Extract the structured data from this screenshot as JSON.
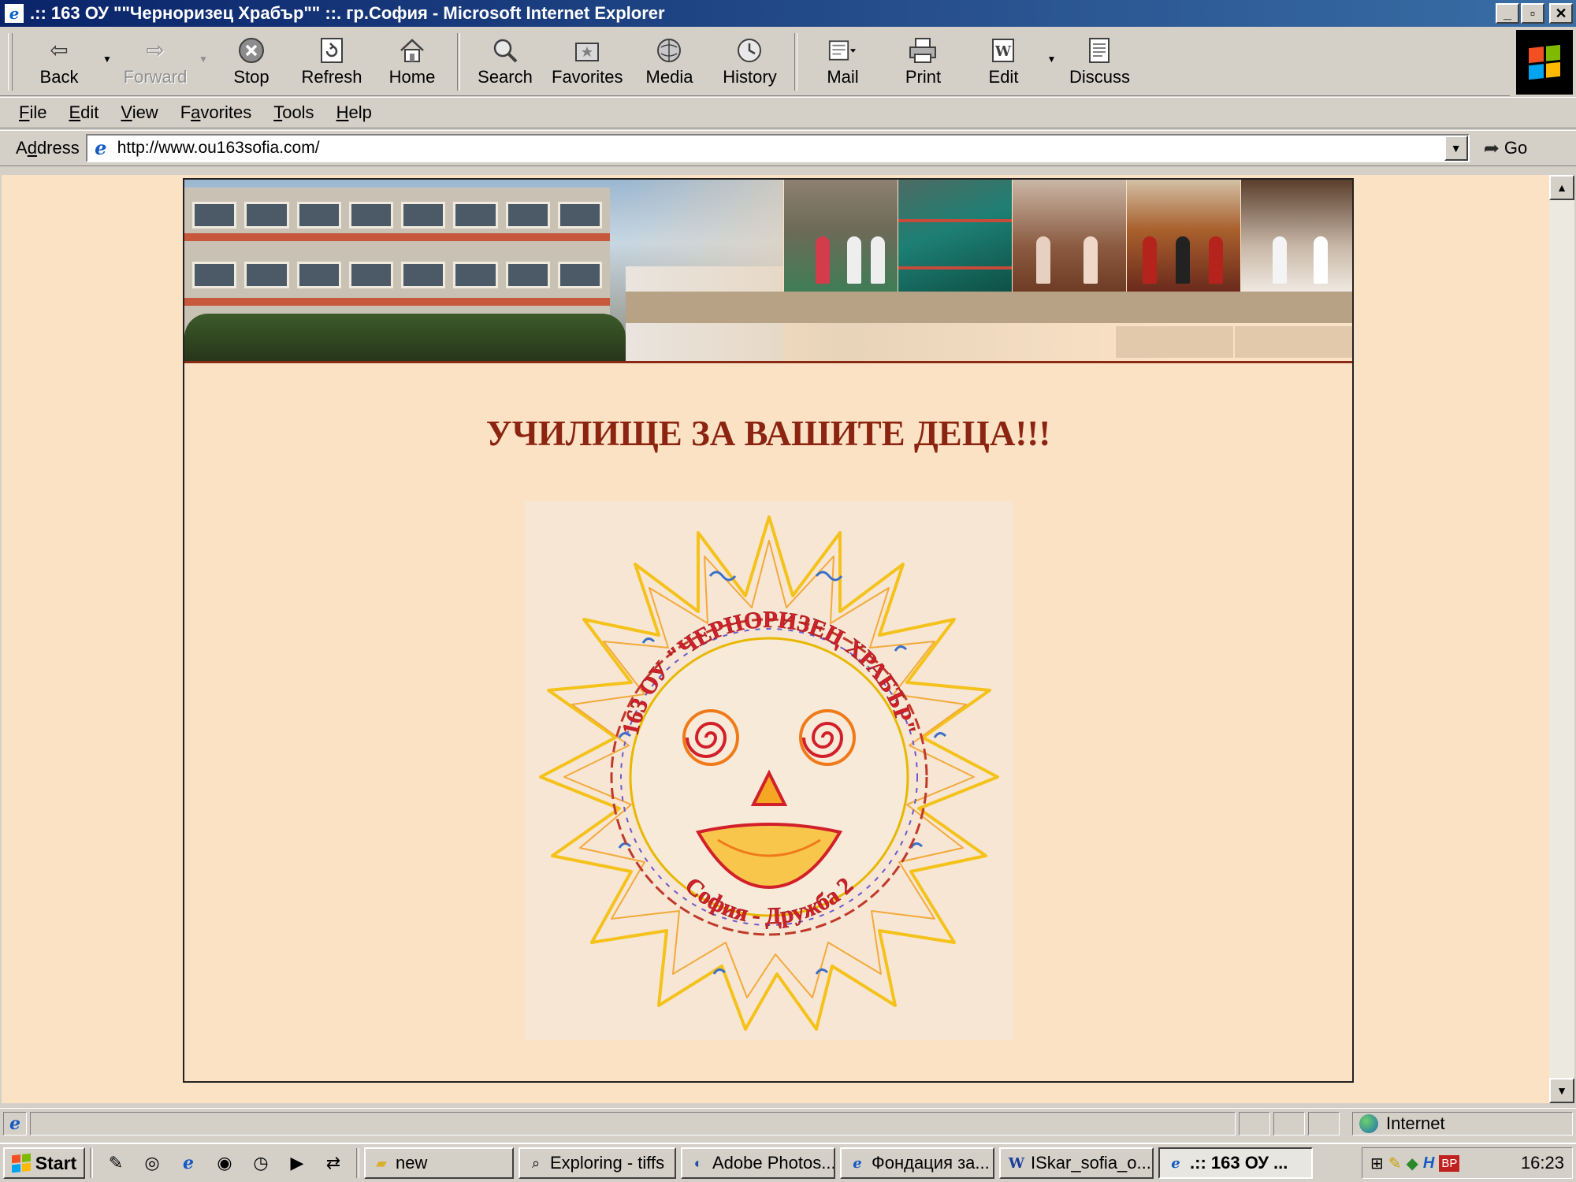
{
  "window": {
    "title": ".:: 163 ОУ \"\"Черноризец Храбър\"\" ::. гр.София - Microsoft Internet Explorer",
    "controls": {
      "minimize": "_",
      "maximize": "▫",
      "close": "✕"
    }
  },
  "toolbar": {
    "buttons": [
      {
        "label": "Back",
        "icon": "back-arrow-icon",
        "enabled": true
      },
      {
        "label": "Forward",
        "icon": "forward-arrow-icon",
        "enabled": false
      },
      {
        "label": "Stop",
        "icon": "stop-icon",
        "enabled": true
      },
      {
        "label": "Refresh",
        "icon": "refresh-icon",
        "enabled": true
      },
      {
        "label": "Home",
        "icon": "home-icon",
        "enabled": true
      },
      {
        "label": "Search",
        "icon": "search-icon",
        "enabled": true
      },
      {
        "label": "Favorites",
        "icon": "favorites-icon",
        "enabled": true
      },
      {
        "label": "Media",
        "icon": "media-icon",
        "enabled": true
      },
      {
        "label": "History",
        "icon": "history-icon",
        "enabled": true
      },
      {
        "label": "Mail",
        "icon": "mail-icon",
        "enabled": true
      },
      {
        "label": "Print",
        "icon": "printer-icon",
        "enabled": true
      },
      {
        "label": "Edit",
        "icon": "word-edit-icon",
        "enabled": true
      },
      {
        "label": "Discuss",
        "icon": "discuss-icon",
        "enabled": true
      }
    ]
  },
  "menu": {
    "items": [
      {
        "label": "File",
        "accel": "F"
      },
      {
        "label": "Edit",
        "accel": "E"
      },
      {
        "label": "View",
        "accel": "V"
      },
      {
        "label": "Favorites",
        "accel": "a"
      },
      {
        "label": "Tools",
        "accel": "T"
      },
      {
        "label": "Help",
        "accel": "H"
      }
    ]
  },
  "address": {
    "label": "Address",
    "url": "http://www.ou163sofia.com/",
    "go_label": "Go"
  },
  "page": {
    "headline": "УЧИЛИЩЕ ЗА ВАШИТЕ ДЕЦА!!!",
    "logo": {
      "top_text": "163 ОУ \"ЧЕРНОРИЗЕЦ ХРАБЪР\"",
      "bottom_text": "София - Дружба 2"
    },
    "colors": {
      "background": "#fbe2c5",
      "headline": "#8b2410"
    }
  },
  "status": {
    "text": "",
    "zone": "Internet"
  },
  "taskbar": {
    "start_label": "Start",
    "tasks": [
      {
        "label": "new",
        "icon": "folder-icon",
        "active": false
      },
      {
        "label": "Exploring - tiffs",
        "icon": "explorer-icon",
        "active": false
      },
      {
        "label": "Adobe Photos...",
        "icon": "photoshop-icon",
        "active": false
      },
      {
        "label": "Фондация за...",
        "icon": "ie-icon",
        "active": false
      },
      {
        "label": "ISkar_sofia_o...",
        "icon": "word-icon",
        "active": false
      },
      {
        "label": ".:: 163 ОУ ...",
        "icon": "ie-icon",
        "active": true
      }
    ],
    "tray": {
      "clock": "16:23"
    }
  }
}
